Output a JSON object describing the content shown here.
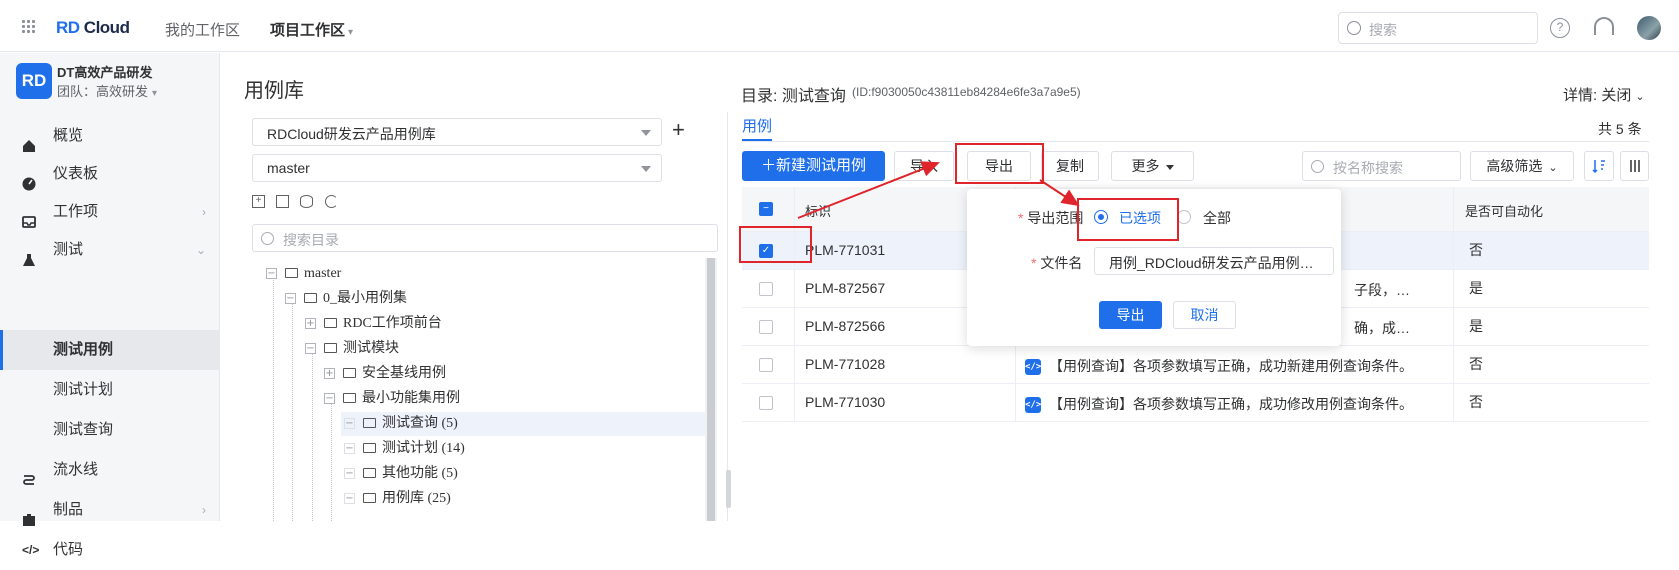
{
  "colors": {
    "accent": "#1f6feb",
    "annotation": "#e0242b"
  },
  "topbar": {
    "logo_rd": "RD",
    "logo_cloud": "Cloud",
    "nav_my": "我的工作区",
    "nav_project": "项目工作区",
    "search_placeholder": "搜索",
    "icons": [
      "apps-grid-icon",
      "help-icon",
      "headset-icon",
      "user-avatar"
    ]
  },
  "sidebar": {
    "team_badge": "RD",
    "team_name": "DT高效产品研发",
    "team_sub": "团队：高效研发",
    "items": [
      {
        "label": "概览",
        "icon": "home-icon"
      },
      {
        "label": "仪表板",
        "icon": "dashboard-icon"
      },
      {
        "label": "工作项",
        "icon": "inbox-icon"
      },
      {
        "label": "测试",
        "icon": "flask-icon"
      },
      {
        "label": "测试用例"
      },
      {
        "label": "测试计划"
      },
      {
        "label": "测试查询"
      },
      {
        "label": "流水线",
        "icon": "pipeline-icon"
      },
      {
        "label": "制品",
        "icon": "package-icon"
      },
      {
        "label": "代码",
        "icon": "code-icon"
      }
    ]
  },
  "library": {
    "title": "用例库",
    "repo_select": "RDCloud研发云产品用例库",
    "branch_select": "master",
    "add": "+",
    "search_placeholder": "搜索目录",
    "tree": [
      {
        "label": "master",
        "mark": "−"
      },
      {
        "label": "0_最小用例集",
        "mark": "−"
      },
      {
        "label": "RDC工作项前台",
        "mark": "+"
      },
      {
        "label": "测试模块",
        "mark": "−"
      },
      {
        "label": "安全基线用例",
        "mark": "+"
      },
      {
        "label": "最小功能集用例",
        "mark": "−"
      },
      {
        "label": "测试查询 (5)",
        "mark": "−"
      },
      {
        "label": "测试计划 (14)",
        "mark": "−"
      },
      {
        "label": "其他功能 (5)",
        "mark": "−"
      },
      {
        "label": "用例库 (25)",
        "mark": "−"
      }
    ]
  },
  "main": {
    "dir_title": "目录: 测试查询",
    "dir_id": "(ID:f9030050c43811eb84284e6fe3a7a9e5)",
    "detail": "详情: 关闭",
    "tab": "用例",
    "count": "共 5 条",
    "buttons": {
      "new": "＋新建测试用例",
      "import": "导入",
      "export": "导出",
      "copy": "复制",
      "more": "更多",
      "adv_filter": "高级筛选"
    },
    "name_search_placeholder": "按名称搜索",
    "columns": {
      "id": "标识",
      "auto": "是否可自动化"
    },
    "rows": [
      {
        "id": "PLM-771031",
        "title": "",
        "auto": "否",
        "checked": true
      },
      {
        "id": "PLM-872567",
        "title": "子段，…",
        "auto": "是",
        "checked": false
      },
      {
        "id": "PLM-872566",
        "title": "确，成…",
        "auto": "是",
        "checked": false
      },
      {
        "id": "PLM-771028",
        "title": "【用例查询】各项参数填写正确，成功新建用例查询条件。",
        "auto": "否",
        "checked": false
      },
      {
        "id": "PLM-771030",
        "title": "【用例查询】各项参数填写正确，成功修改用例查询条件。",
        "auto": "否",
        "checked": false
      }
    ]
  },
  "export_popover": {
    "range_label": "导出范围",
    "opt_selected": "已选项",
    "opt_all": "全部",
    "filename_label": "文件名",
    "filename_value": "用例_RDCloud研发云产品用例…",
    "confirm": "导出",
    "cancel": "取消",
    "required_mark": "*"
  }
}
